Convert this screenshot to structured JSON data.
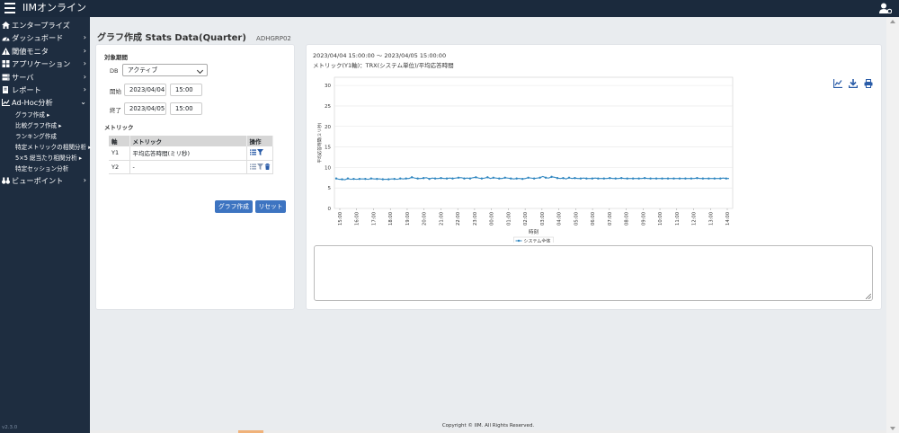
{
  "app": {
    "title": "IIMオンライン",
    "version": "v2.3.0"
  },
  "nav": [
    {
      "label": "エンタープライズ",
      "icon": "home-icon",
      "chevron": false
    },
    {
      "label": "ダッシュボード",
      "icon": "dashboard-icon",
      "chevron": true
    },
    {
      "label": "閾値モニタ",
      "icon": "warning-icon",
      "chevron": true
    },
    {
      "label": "アプリケーション",
      "icon": "grid-icon",
      "chevron": true
    },
    {
      "label": "サーバ",
      "icon": "server-icon",
      "chevron": true
    },
    {
      "label": "レポート",
      "icon": "report-icon",
      "chevron": true
    },
    {
      "label": "Ad-Hoc分析",
      "icon": "chart-icon",
      "chevron": false,
      "expanded": true
    }
  ],
  "subnav": [
    "グラフ作成 ▸",
    "比較グラフ作成 ▸",
    "ランキング作成",
    "特定メトリックの相関分析 ▸",
    "5×5 総当たり相関分析 ▸",
    "特定セッション分析"
  ],
  "nav_last": {
    "label": "ビューポイント",
    "icon": "binoculars-icon",
    "chevron": true
  },
  "page": {
    "title": "グラフ作成 Stats Data(Quarter)",
    "code": "ADHGRP02"
  },
  "form": {
    "section_target": "対象期間",
    "db_label": "DB",
    "db_value": "アクティブ",
    "start_label": "開始",
    "start_date": "2023/04/04",
    "start_time": "15:00",
    "end_label": "終了",
    "end_date": "2023/04/05",
    "end_time": "15:00",
    "section_metric": "メトリック",
    "table_headers": [
      "軸",
      "メトリック",
      "操作"
    ],
    "rows": [
      {
        "axis": "Y1",
        "metric": "平均応答時間(ミリ秒)"
      },
      {
        "axis": "Y2",
        "metric": "-"
      }
    ],
    "create_button": "グラフ作成",
    "reset_button": "リセット"
  },
  "chart_header": {
    "range": "2023/04/04 15:00:00 〜 2023/04/05 15:00:00",
    "metric": "メトリック(Y1軸)：TRX(システム単位)/平均応答時間"
  },
  "toolbar_icons": [
    "chart-icon",
    "download-icon",
    "print-icon"
  ],
  "chart_data": {
    "type": "line",
    "title": "",
    "xlabel": "時刻",
    "ylabel": "平均応答時間(ミリ秒)",
    "ylim": [
      0,
      32
    ],
    "yticks": [
      0,
      5,
      10,
      15,
      20,
      25,
      30
    ],
    "categories": [
      "15:00",
      "16:00",
      "17:00",
      "18:00",
      "19:00",
      "20:00",
      "21:00",
      "22:00",
      "23:00",
      "00:00",
      "01:00",
      "02:00",
      "03:00",
      "04:00",
      "05:00",
      "06:00",
      "07:00",
      "08:00",
      "09:00",
      "10:00",
      "11:00",
      "12:00",
      "13:00",
      "14:00"
    ],
    "grid": true,
    "legend": "bottom-center",
    "color": "#2f86c0",
    "series": [
      {
        "name": "システム全体",
        "values": [
          7.3,
          7.1,
          7.1,
          7.0,
          7.3,
          7.1,
          7.2,
          7.1,
          7.2,
          7.2,
          7.2,
          7.1,
          7.3,
          7.2,
          7.2,
          7.2,
          7.1,
          7.1,
          7.1,
          7.2,
          7.2,
          7.1,
          7.3,
          7.2,
          7.3,
          7.3,
          7.6,
          7.4,
          7.3,
          7.3,
          7.4,
          7.5,
          7.2,
          7.4,
          7.3,
          7.3,
          7.4,
          7.3,
          7.3,
          7.4,
          7.3,
          7.4,
          7.5,
          7.5,
          7.3,
          7.4,
          7.3,
          7.5,
          7.6,
          7.4,
          7.3,
          7.4,
          7.6,
          7.3,
          7.5,
          7.4,
          7.3,
          7.3,
          7.5,
          7.4,
          7.3,
          7.2,
          7.3,
          7.3,
          7.2,
          7.3,
          7.5,
          7.4,
          7.3,
          7.4,
          7.5,
          7.8,
          7.5,
          7.4,
          7.7,
          7.6,
          7.4,
          7.3,
          7.4,
          7.2,
          7.5,
          7.3,
          7.4,
          7.3,
          7.3,
          7.4,
          7.3,
          7.3,
          7.3,
          7.4,
          7.3,
          7.3,
          7.3,
          7.3,
          7.4,
          7.3,
          7.3,
          7.3,
          7.4,
          7.3,
          7.3,
          7.3,
          7.3,
          7.3,
          7.3,
          7.3,
          7.4,
          7.3,
          7.3,
          7.3,
          7.3,
          7.3,
          7.3,
          7.3,
          7.3,
          7.3,
          7.3,
          7.3,
          7.3,
          7.3,
          7.3,
          7.3,
          7.3,
          7.3,
          7.4,
          7.3,
          7.3,
          7.3,
          7.3,
          7.3,
          7.3,
          7.3,
          7.3,
          7.4,
          7.3,
          7.3
        ]
      }
    ]
  },
  "footer": "Copyright © IIM. All Rights Reserved."
}
